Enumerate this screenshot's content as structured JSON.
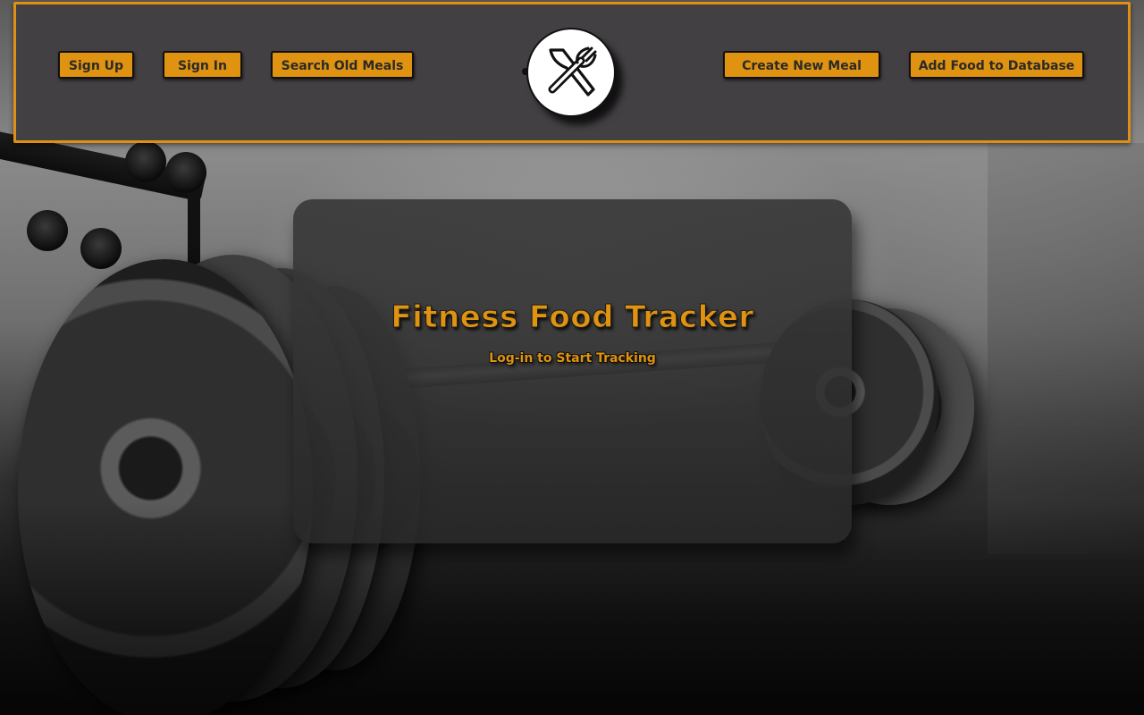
{
  "header": {
    "left_nav": [
      {
        "label": "Sign Up"
      },
      {
        "label": "Sign In"
      },
      {
        "label": "Search Old Meals"
      }
    ],
    "logo_icon": "fork-and-knife-icon",
    "right_nav": [
      {
        "label": "Create New Meal"
      },
      {
        "label": "Add Food to Database"
      }
    ]
  },
  "hero": {
    "title": "Fitness Food Tracker",
    "subtitle": "Log-in to Start Tracking"
  },
  "background": {
    "description_icon": "barbell-gym-photo"
  },
  "colors": {
    "accent": "#df9310",
    "header_bg": "#434043",
    "card_bg": "#3a3a3a",
    "text_dark": "#2a2a2a"
  }
}
